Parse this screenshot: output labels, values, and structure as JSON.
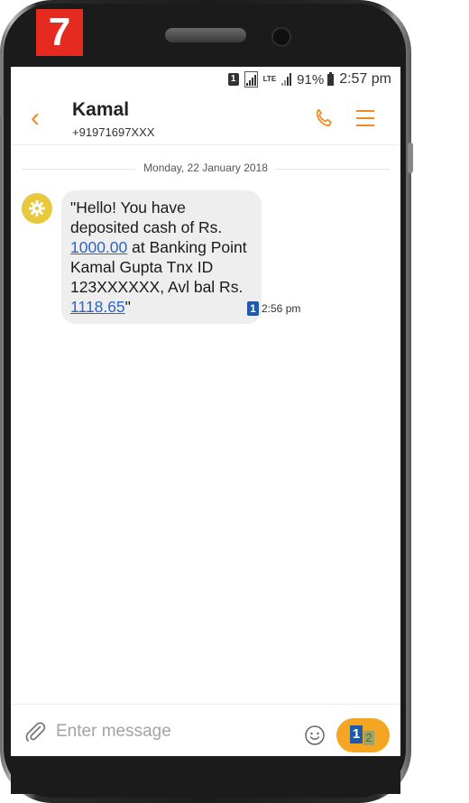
{
  "step": {
    "number": "7",
    "color": "#e52b1f"
  },
  "status_bar": {
    "sim_label": "1",
    "network": "LTE",
    "battery": "91%",
    "time": "2:57 pm"
  },
  "header": {
    "contact_name": "Kamal",
    "contact_number": "+91971697XXX",
    "accent_color": "#f08a24",
    "icons": [
      "chevron-left-icon",
      "phone-icon",
      "menu-icon"
    ]
  },
  "conversation": {
    "date_divider": "Monday, 22 January 2018",
    "messages": [
      {
        "sender_avatar": "gear-icon",
        "text_parts": {
          "p1": "\"Hello! You have deposited cash of Rs. ",
          "amount": "1000.00",
          "p2": " at Banking Point Kamal Gupta Tnx ID 123XXXXXX, Avl bal Rs. ",
          "balance": "1118.65",
          "p3": "\""
        },
        "sim": "1",
        "time": "2:56 pm"
      }
    ]
  },
  "composer": {
    "placeholder": "Enter message",
    "send_sim_primary": "1",
    "send_sim_secondary": "2",
    "send_color": "#f4a623"
  }
}
